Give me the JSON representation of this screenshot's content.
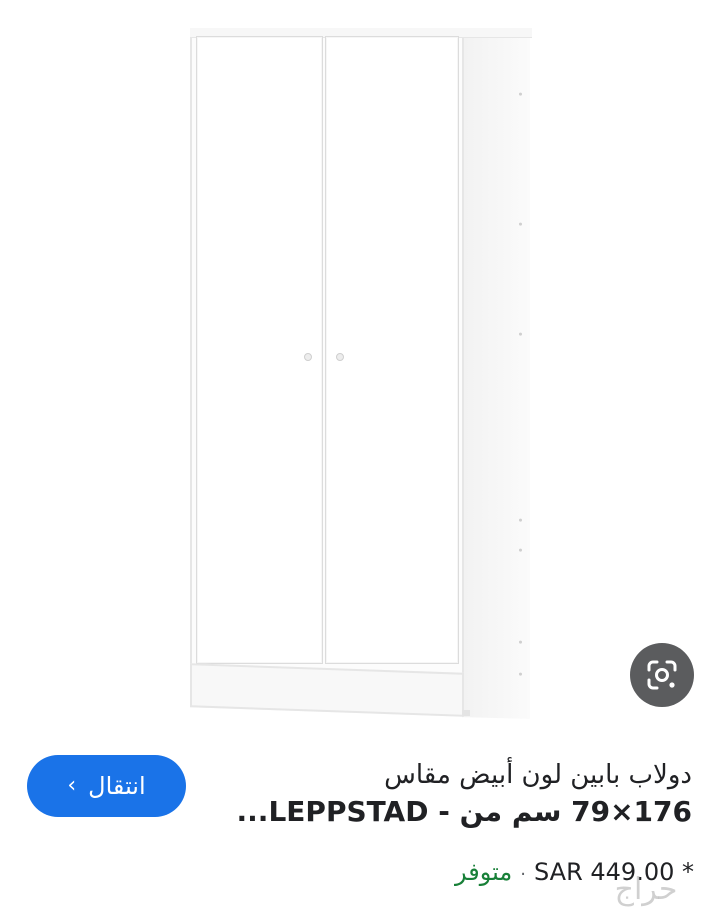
{
  "product": {
    "title_line1": "دولاب بابين لون أبيض مقاس",
    "title_line2": "176×79 سم من - LEPPSTAD...",
    "price": "SAR 449.00 *",
    "separator": "·",
    "availability": "متوفر"
  },
  "actions": {
    "visit_label": "انتقال",
    "visit_icon": "chevron-right",
    "lens_icon": "google-lens"
  },
  "colors": {
    "accent": "#1a73e8",
    "in_stock": "#188038",
    "lens_bg": "#5b5c5e"
  }
}
